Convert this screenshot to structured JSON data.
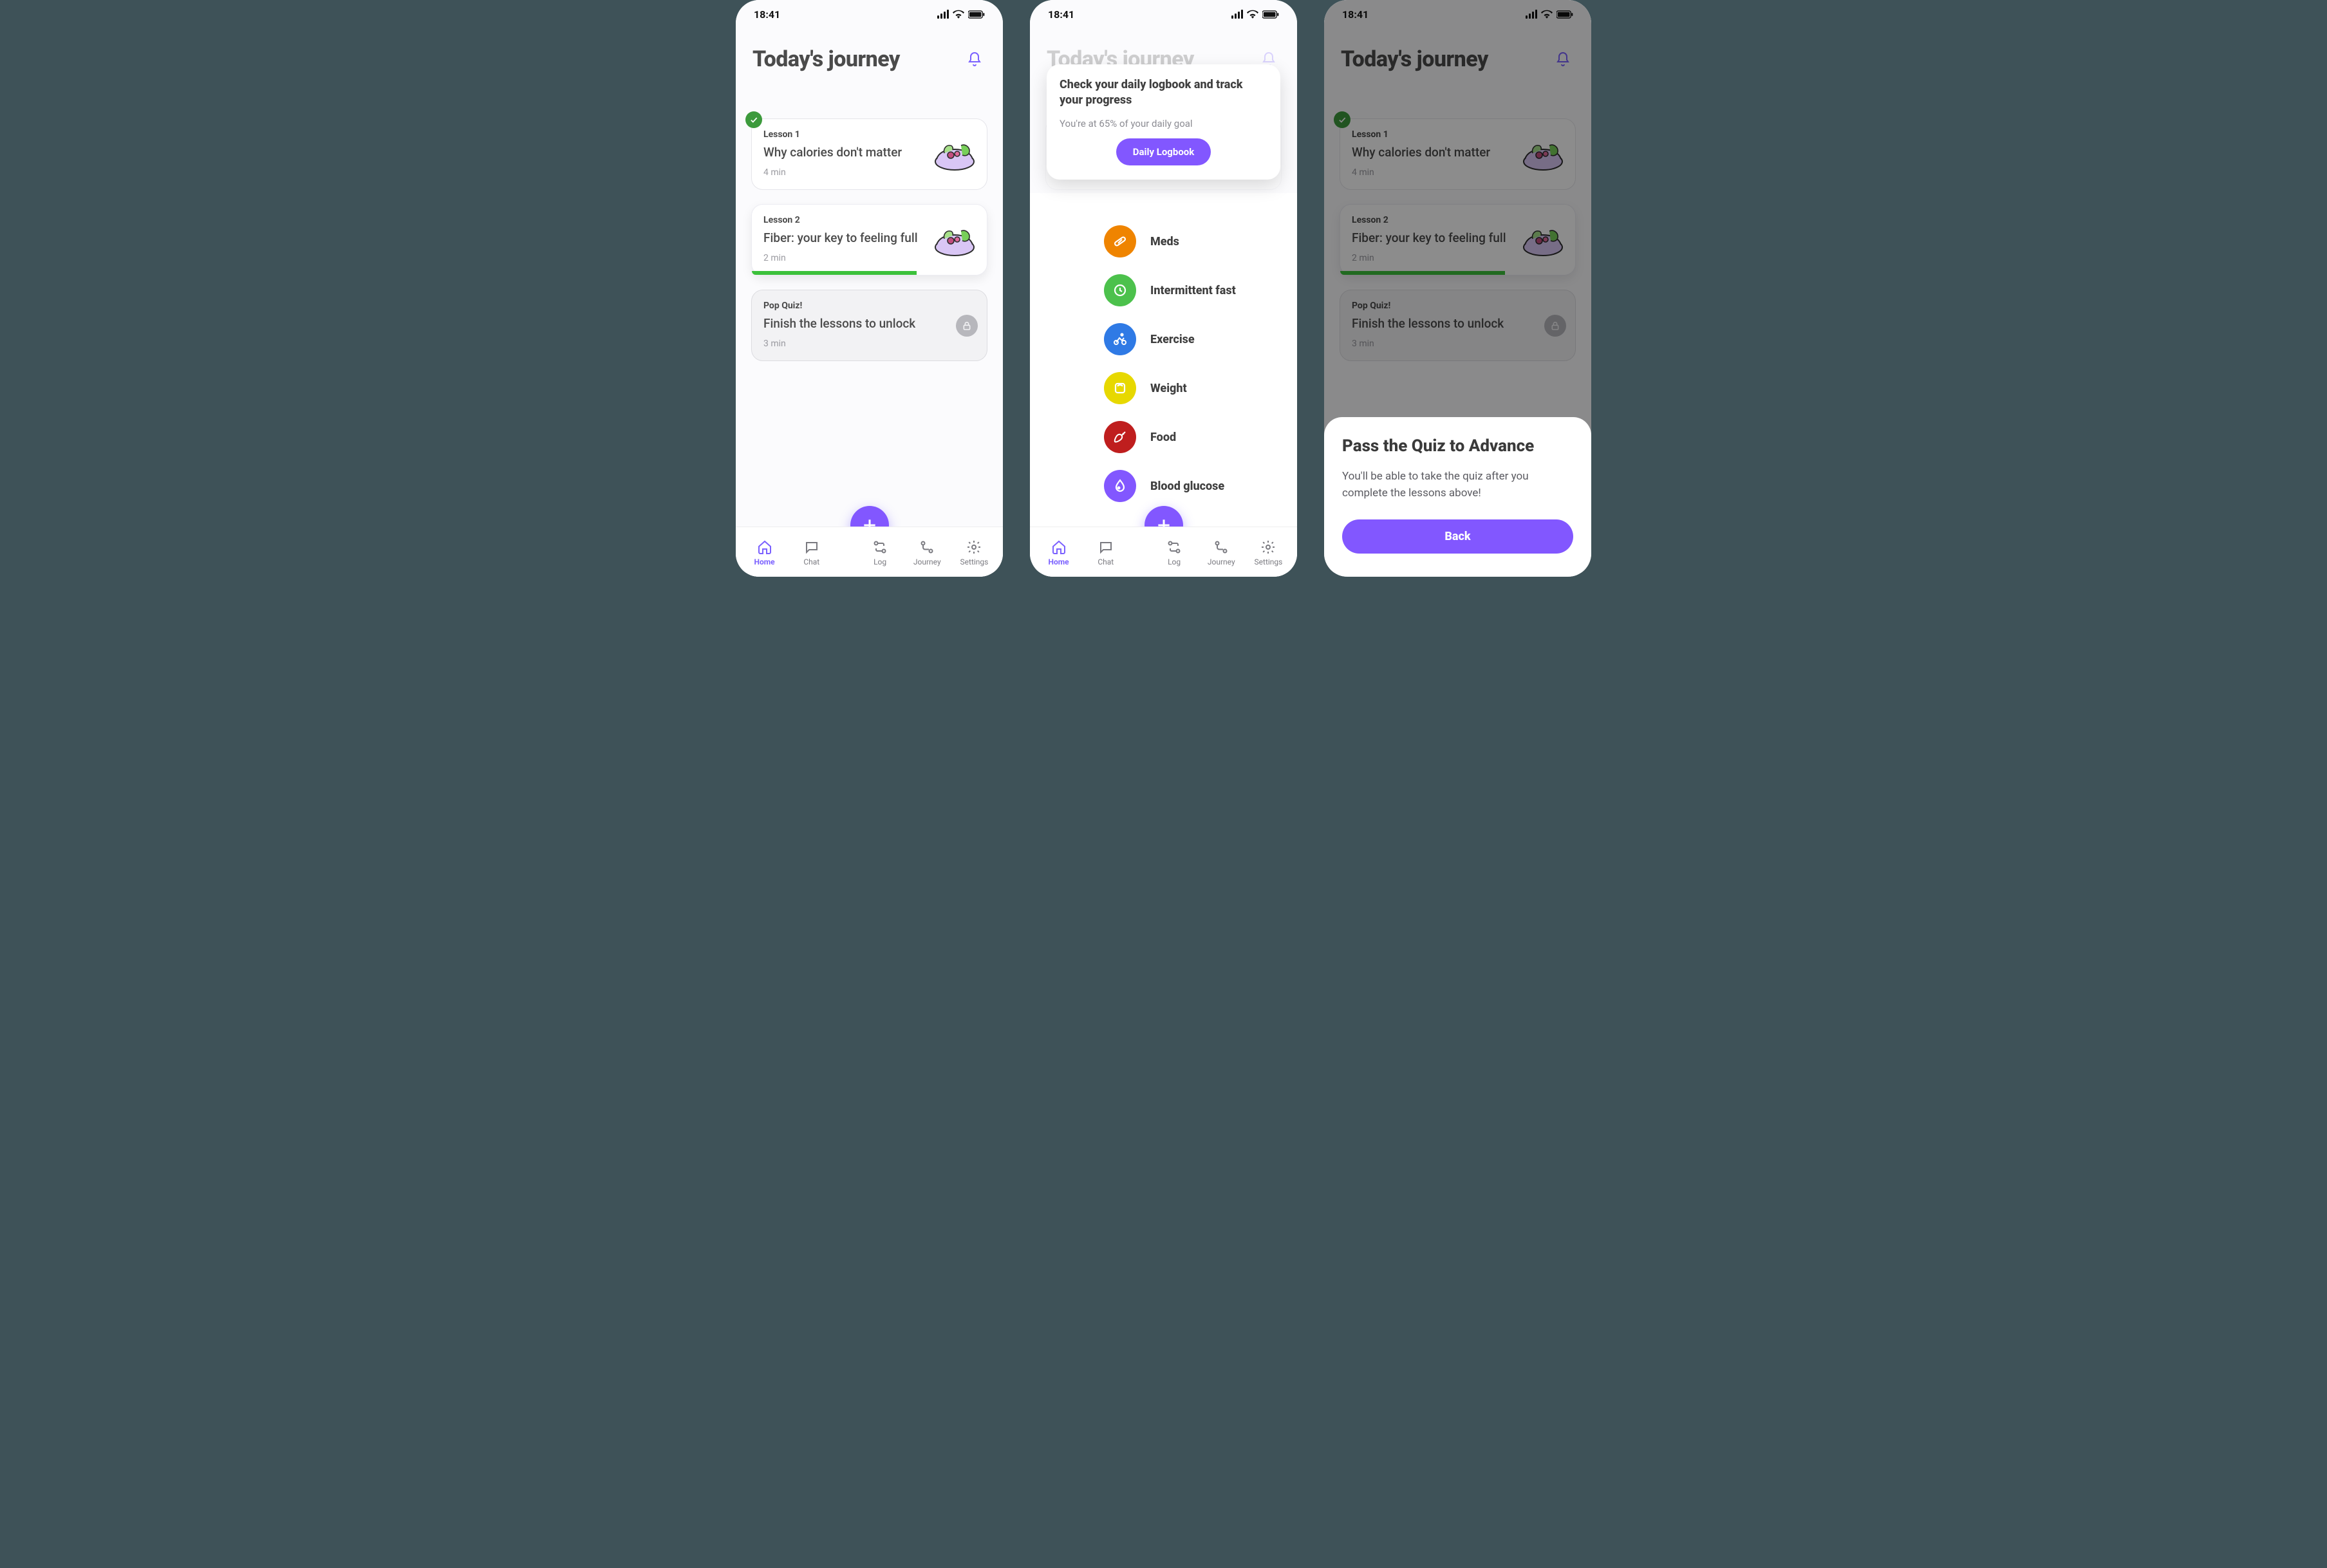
{
  "status": {
    "time": "18:41"
  },
  "header": {
    "title": "Today's journey"
  },
  "cards": {
    "lesson1": {
      "label": "Lesson 1",
      "title": "Why calories don't matter",
      "meta": "4 min"
    },
    "lesson2": {
      "label": "Lesson 2",
      "title": "Fiber: your key to feeling full",
      "meta": "2 min"
    },
    "quiz": {
      "label": "Pop Quiz!",
      "title": "Finish the lessons to unlock",
      "meta": "3 min"
    }
  },
  "nav": {
    "home": "Home",
    "chat": "Chat",
    "log": "Log",
    "journey": "Journey",
    "settings": "Settings"
  },
  "logbook_panel": {
    "title": "Check your daily logbook and track your progress",
    "sub": "You're at 65% of your daily goal",
    "cta": "Daily Logbook"
  },
  "log_items": {
    "meds": "Meds",
    "fast": "Intermittent fast",
    "exercise": "Exercise",
    "weight": "Weight",
    "food": "Food",
    "glucose": "Blood glucose"
  },
  "quiz_sheet": {
    "title": "Pass the Quiz to Advance",
    "body": "You'll be able to take the quiz after you complete the lessons above!",
    "cta": "Back"
  }
}
